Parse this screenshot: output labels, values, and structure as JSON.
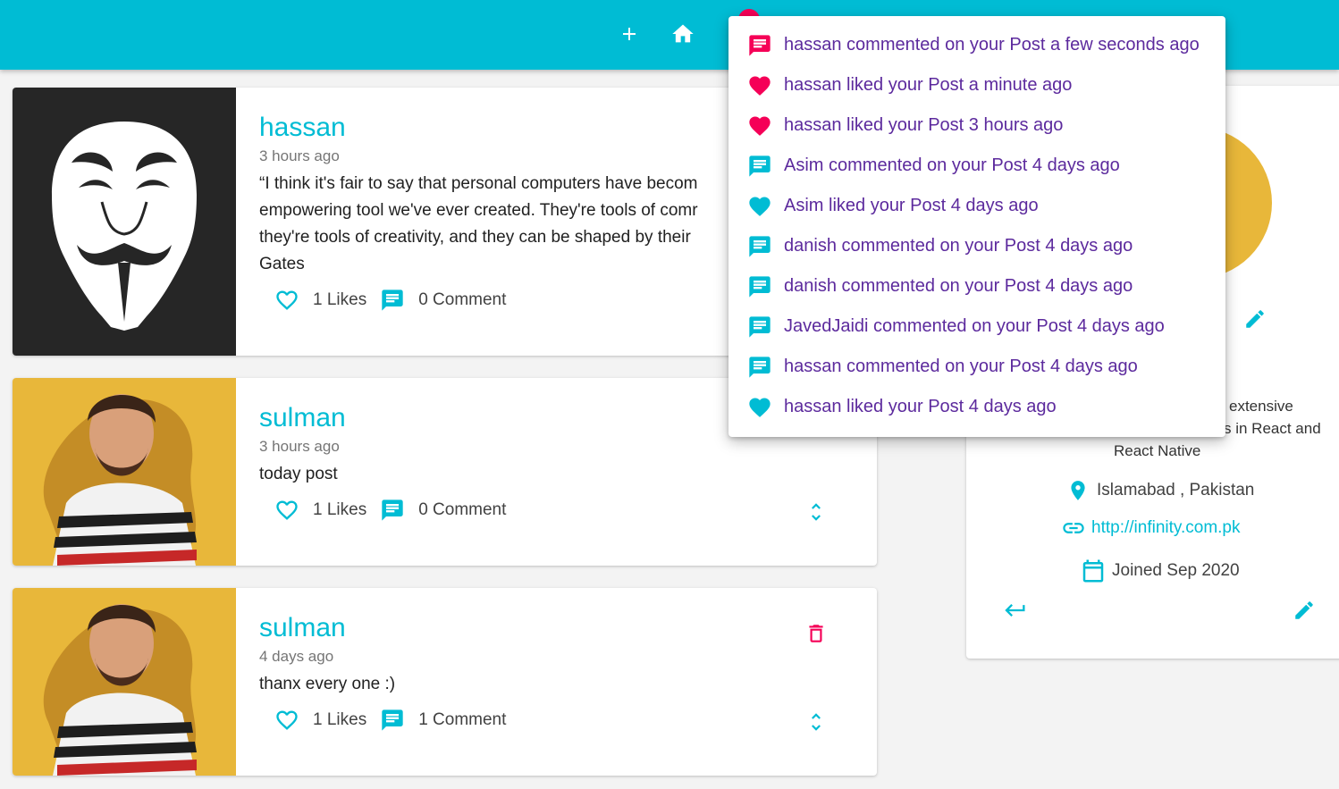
{
  "colors": {
    "primary": "#00bcd4",
    "accent": "#f50057",
    "link_purple": "#5c2a9d"
  },
  "navbar": {
    "icons": [
      "plus-icon",
      "home-icon",
      "notifications-icon"
    ]
  },
  "posts": [
    {
      "username": "hassan",
      "time": "3 hours ago",
      "body_lines": [
        "“I think it's fair to say that personal computers have becom",
        "empowering tool we've ever created. They're tools of comr",
        "they're tools of creativity, and they can be shaped by their",
        "Gates"
      ],
      "likes": "1 Likes",
      "comments": "0 Comment"
    },
    {
      "username": "sulman",
      "time": "3 hours ago",
      "body_lines": [
        "today post"
      ],
      "likes": "1 Likes",
      "comments": "0 Comment"
    },
    {
      "username": "sulman",
      "time": "4 days ago",
      "body_lines": [
        "thanx every one :)"
      ],
      "likes": "1 Likes",
      "comments": "1 Comment"
    }
  ],
  "profile": {
    "bio_lines": [
      "extensive",
      "s in React and",
      "React Native"
    ],
    "location": "Islamabad , Pakistan",
    "website": "http://infinity.com.pk",
    "joined": "Joined Sep 2020"
  },
  "notifications": [
    {
      "type": "comment",
      "color": "#f50057",
      "text": "hassan commented on your Post a few seconds ago"
    },
    {
      "type": "like",
      "color": "#f50057",
      "text": "hassan liked your Post a minute ago"
    },
    {
      "type": "like",
      "color": "#f50057",
      "text": "hassan liked your Post 3 hours ago"
    },
    {
      "type": "comment",
      "color": "#00bcd4",
      "text": "Asim commented on your Post 4 days ago"
    },
    {
      "type": "like",
      "color": "#00bcd4",
      "text": "Asim liked your Post 4 days ago"
    },
    {
      "type": "comment",
      "color": "#00bcd4",
      "text": "danish commented on your Post 4 days ago"
    },
    {
      "type": "comment",
      "color": "#00bcd4",
      "text": "danish commented on your Post 4 days ago"
    },
    {
      "type": "comment",
      "color": "#00bcd4",
      "text": "JavedJaidi commented on your Post 4 days ago"
    },
    {
      "type": "comment",
      "color": "#00bcd4",
      "text": "hassan commented on your Post 4 days ago"
    },
    {
      "type": "like",
      "color": "#00bcd4",
      "text": "hassan liked your Post 4 days ago"
    }
  ]
}
